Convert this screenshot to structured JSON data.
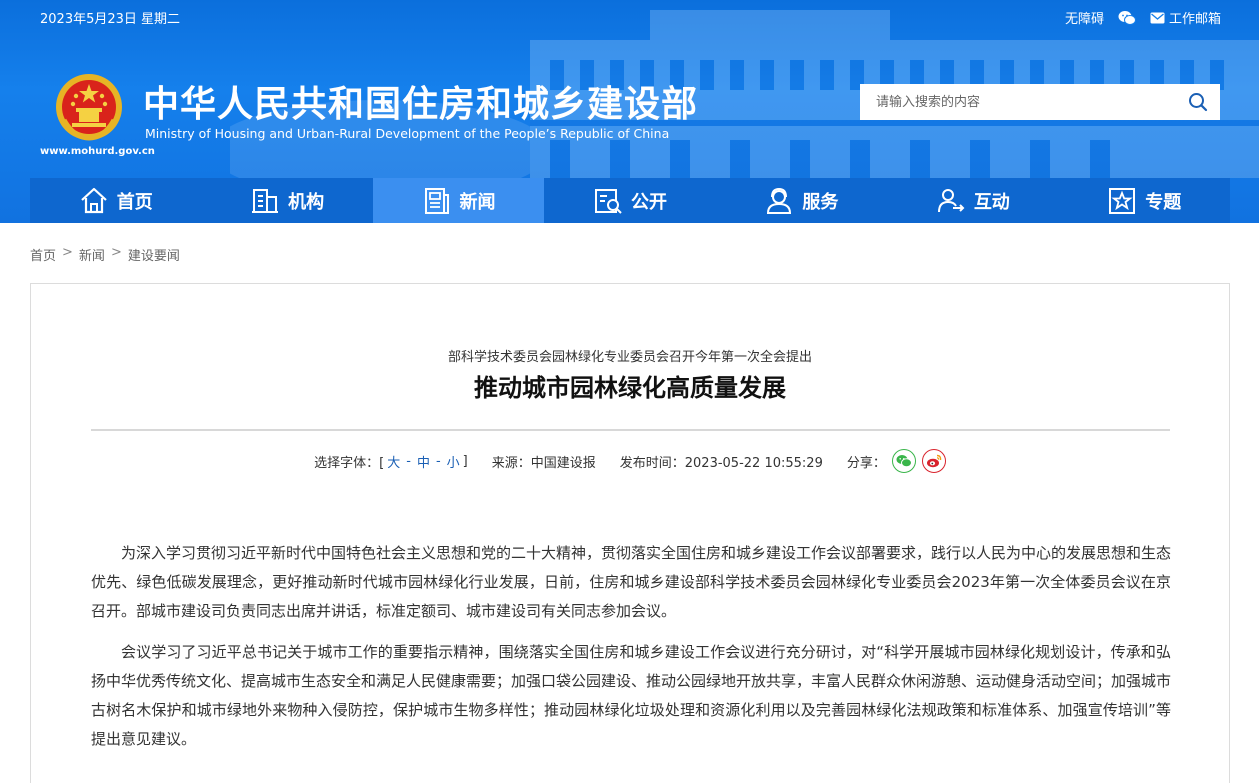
{
  "topbar": {
    "date": "2023年5月23日 星期二",
    "accessibility": "无障碍",
    "wechat_icon": "wechat-icon",
    "mail_label": "工作邮箱"
  },
  "brand": {
    "title": "中华人民共和国住房和城乡建设部",
    "subtitle": "Ministry of Housing and Urban-Rural Development of the People’s Republic of China",
    "url": "www.mohurd.gov.cn",
    "emblem": "national-emblem"
  },
  "search": {
    "placeholder": "请输入搜索的内容"
  },
  "nav": {
    "items": [
      {
        "label": "首页",
        "icon": "home-icon"
      },
      {
        "label": "机构",
        "icon": "building-icon"
      },
      {
        "label": "新闻",
        "icon": "news-icon",
        "active": true
      },
      {
        "label": "公开",
        "icon": "disclosure-icon"
      },
      {
        "label": "服务",
        "icon": "service-icon"
      },
      {
        "label": "互动",
        "icon": "interaction-icon"
      },
      {
        "label": "专题",
        "icon": "topic-icon"
      }
    ]
  },
  "breadcrumb": {
    "items": [
      "首页",
      "新闻",
      "建设要闻"
    ],
    "separator": ">"
  },
  "article": {
    "kicker": "部科学技术委员会园林绿化专业委员会召开今年第一次全会提出",
    "title": "推动城市园林绿化高质量发展",
    "font_select_label": "选择字体：[",
    "font_sizes": [
      "大",
      "中",
      "小"
    ],
    "font_select_close": "]",
    "dash": "-",
    "source": "来源：中国建设报",
    "published": "发布时间：2023-05-22 10:55:29",
    "share_label": "分享：",
    "paragraphs": [
      "为深入学习贯彻习近平新时代中国特色社会主义思想和党的二十大精神，贯彻落实全国住房和城乡建设工作会议部署要求，践行以人民为中心的发展思想和生态优先、绿色低碳发展理念，更好推动新时代城市园林绿化行业发展，日前，住房和城乡建设部科学技术委员会园林绿化专业委员会2023年第一次全体委员会议在京召开。部城市建设司负责同志出席并讲话，标准定额司、城市建设司有关同志参加会议。",
      "会议学习了习近平总书记关于城市工作的重要指示精神，围绕落实全国住房和城乡建设工作会议进行充分研讨，对“科学开展城市园林绿化规划设计，传承和弘扬中华优秀传统文化、提高城市生态安全和满足人民健康需要；加强口袋公园建设、推动公园绿地开放共享，丰富人民群众休闲游憩、运动健身活动空间；加强城市古树名木保护和城市绿地外来物种入侵防控，保护城市生物多样性；推动园林绿化垃圾处理和资源化利用以及完善园林绿化法规政策和标准体系、加强宣传培训”等提出意见建议。"
    ]
  },
  "colors": {
    "header_blue": "#1580ec",
    "nav_blue": "#0e67cf",
    "nav_active": "#3b8ff0",
    "link_blue": "#1a5fb4",
    "wechat_green": "#39b54a",
    "weibo_red": "#d9232d"
  }
}
